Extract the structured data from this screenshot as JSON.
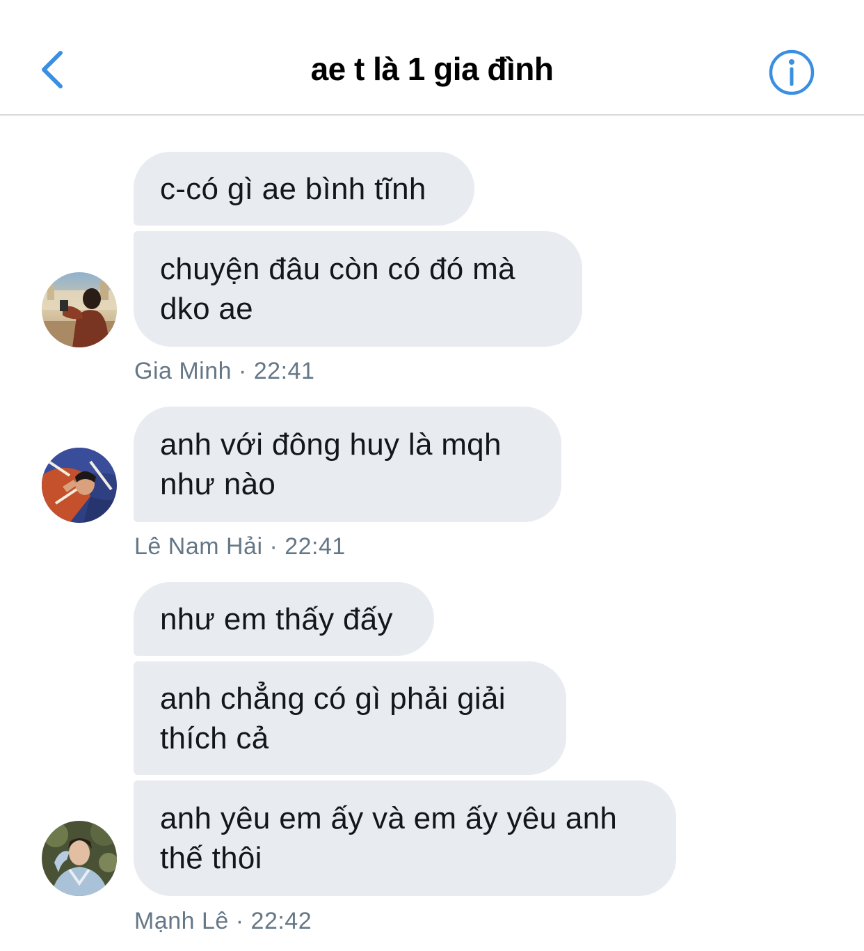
{
  "header": {
    "title": "ae t là 1 gia đình",
    "back_icon": "chevron-left-icon",
    "info_icon": "info-circle-icon",
    "accent_color": "#3a8fe0"
  },
  "messages": {
    "group1": {
      "bubbles": [
        "c-có gì ae bình tĩnh",
        "chuyện đâu còn có đó mà\ndko ae"
      ],
      "sender": "Gia Minh",
      "time": "22:41",
      "meta": "Gia Minh · 22:41"
    },
    "group2": {
      "bubbles": [
        "anh với đông huy là mqh\nnhư nào"
      ],
      "sender": "Lê Nam Hải",
      "time": "22:41",
      "meta": "Lê Nam Hải · 22:41"
    },
    "group3": {
      "bubbles": [
        "như em thấy đấy",
        "anh chẳng có gì phải giải\nthích cả",
        "anh yêu em ấy và em ấy yêu anh\nthế thôi"
      ],
      "sender": "Mạnh Lê",
      "time": "22:42",
      "meta": "Mạnh Lê · 22:42"
    }
  },
  "colors": {
    "bubble_bg": "#e8ebf0",
    "meta_text": "#657786"
  }
}
